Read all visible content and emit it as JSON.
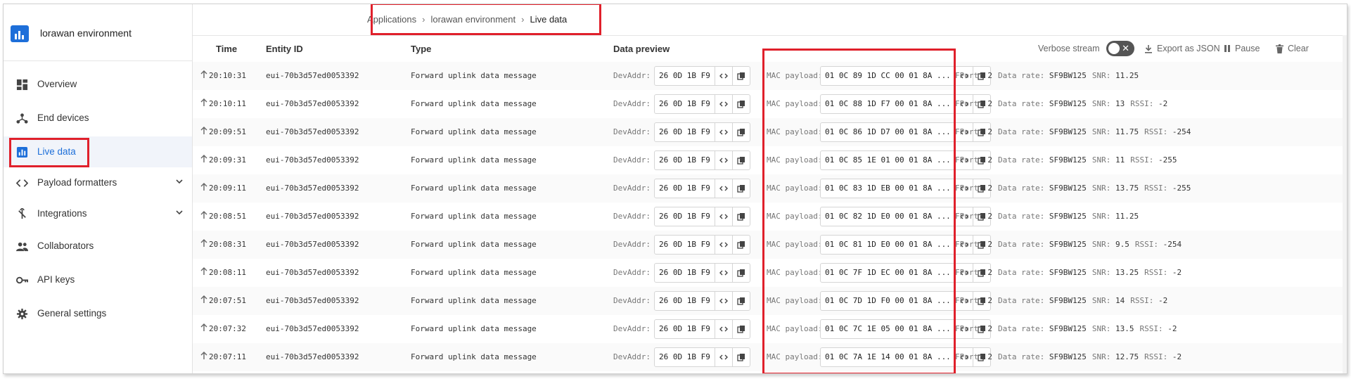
{
  "app": {
    "title": "lorawan environment"
  },
  "breadcrumb": [
    "Applications",
    "lorawan environment",
    "Live data"
  ],
  "sidebar": {
    "items": [
      {
        "label": "Overview",
        "icon": "grid-icon"
      },
      {
        "label": "End devices",
        "icon": "devices-icon"
      },
      {
        "label": "Live data",
        "icon": "chart-icon",
        "active": true
      },
      {
        "label": "Payload formatters",
        "icon": "code-icon",
        "expandable": true
      },
      {
        "label": "Integrations",
        "icon": "merge-icon",
        "expandable": true
      },
      {
        "label": "Collaborators",
        "icon": "people-icon"
      },
      {
        "label": "API keys",
        "icon": "key-icon"
      },
      {
        "label": "General settings",
        "icon": "gear-icon"
      }
    ]
  },
  "table": {
    "headers": {
      "time": "Time",
      "entity": "Entity ID",
      "type": "Type",
      "preview": "Data preview"
    },
    "controls": {
      "verbose": "Verbose stream",
      "export": "Export as JSON",
      "pause": "Pause",
      "clear": "Clear"
    },
    "labels": {
      "devaddr": "DevAddr:",
      "mac": "MAC payload:",
      "fport": "FPort:",
      "rate": "Data rate:",
      "snr": "SNR:",
      "rssi": "RSSI:"
    },
    "rows": [
      {
        "time": "20:10:31",
        "entity": "eui-70b3d57ed0053392",
        "type": "Forward uplink data message",
        "devaddr": "26 0D 1B F9",
        "mac": "01 0C 89 1D CC 00 01 8A ...",
        "fport": "2",
        "rate": "SF9BW125",
        "snr": "11.25",
        "rssi": ""
      },
      {
        "time": "20:10:11",
        "entity": "eui-70b3d57ed0053392",
        "type": "Forward uplink data message",
        "devaddr": "26 0D 1B F9",
        "mac": "01 0C 88 1D F7 00 01 8A ...",
        "fport": "2",
        "rate": "SF9BW125",
        "snr": "13",
        "rssi": "-2"
      },
      {
        "time": "20:09:51",
        "entity": "eui-70b3d57ed0053392",
        "type": "Forward uplink data message",
        "devaddr": "26 0D 1B F9",
        "mac": "01 0C 86 1D D7 00 01 8A ...",
        "fport": "2",
        "rate": "SF9BW125",
        "snr": "11.75",
        "rssi": "-254"
      },
      {
        "time": "20:09:31",
        "entity": "eui-70b3d57ed0053392",
        "type": "Forward uplink data message",
        "devaddr": "26 0D 1B F9",
        "mac": "01 0C 85 1E 01 00 01 8A ...",
        "fport": "2",
        "rate": "SF9BW125",
        "snr": "11",
        "rssi": "-255"
      },
      {
        "time": "20:09:11",
        "entity": "eui-70b3d57ed0053392",
        "type": "Forward uplink data message",
        "devaddr": "26 0D 1B F9",
        "mac": "01 0C 83 1D EB 00 01 8A ...",
        "fport": "2",
        "rate": "SF9BW125",
        "snr": "13.75",
        "rssi": "-255"
      },
      {
        "time": "20:08:51",
        "entity": "eui-70b3d57ed0053392",
        "type": "Forward uplink data message",
        "devaddr": "26 0D 1B F9",
        "mac": "01 0C 82 1D E0 00 01 8A ...",
        "fport": "2",
        "rate": "SF9BW125",
        "snr": "11.25",
        "rssi": ""
      },
      {
        "time": "20:08:31",
        "entity": "eui-70b3d57ed0053392",
        "type": "Forward uplink data message",
        "devaddr": "26 0D 1B F9",
        "mac": "01 0C 81 1D E0 00 01 8A ...",
        "fport": "2",
        "rate": "SF9BW125",
        "snr": "9.5",
        "rssi": "-254"
      },
      {
        "time": "20:08:11",
        "entity": "eui-70b3d57ed0053392",
        "type": "Forward uplink data message",
        "devaddr": "26 0D 1B F9",
        "mac": "01 0C 7F 1D EC 00 01 8A ...",
        "fport": "2",
        "rate": "SF9BW125",
        "snr": "13.25",
        "rssi": "-2"
      },
      {
        "time": "20:07:51",
        "entity": "eui-70b3d57ed0053392",
        "type": "Forward uplink data message",
        "devaddr": "26 0D 1B F9",
        "mac": "01 0C 7D 1D F0 00 01 8A ...",
        "fport": "2",
        "rate": "SF9BW125",
        "snr": "14",
        "rssi": "-2"
      },
      {
        "time": "20:07:32",
        "entity": "eui-70b3d57ed0053392",
        "type": "Forward uplink data message",
        "devaddr": "26 0D 1B F9",
        "mac": "01 0C 7C 1E 05 00 01 8A ...",
        "fport": "2",
        "rate": "SF9BW125",
        "snr": "13.5",
        "rssi": "-2"
      },
      {
        "time": "20:07:11",
        "entity": "eui-70b3d57ed0053392",
        "type": "Forward uplink data message",
        "devaddr": "26 0D 1B F9",
        "mac": "01 0C 7A 1E 14 00 01 8A ...",
        "fport": "2",
        "rate": "SF9BW125",
        "snr": "12.75",
        "rssi": "-2"
      }
    ]
  },
  "colors": {
    "accent": "#1e6fd9",
    "highlight": "#e0202b"
  }
}
